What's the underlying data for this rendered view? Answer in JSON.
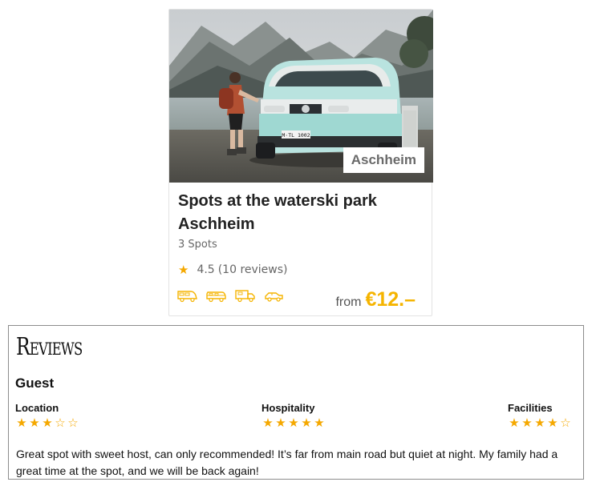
{
  "card": {
    "location_badge": "Aschheim",
    "title": "Spots at the waterski park Aschheim",
    "spot_count": "3 Spots",
    "rating_value": "4.5",
    "rating_reviews": "(10 reviews)",
    "price_from": "from",
    "price_value": "€12.–",
    "vehicle_icons": [
      "motorhome-icon",
      "campervan-icon",
      "truck-camper-icon",
      "car-icon"
    ],
    "van_plate": "M·TL 1002",
    "accent_color": "#f5b400"
  },
  "reviews": {
    "heading": "Reviews",
    "reviewer": "Guest",
    "categories": [
      {
        "label": "Location",
        "stars_filled": 3,
        "stars_total": 5
      },
      {
        "label": "Hospitality",
        "stars_filled": 5,
        "stars_total": 5
      },
      {
        "label": "Facilities",
        "stars_filled": 4,
        "stars_total": 5
      }
    ],
    "text": "Great spot with sweet host, can only recommended! It’s far from main road but quiet at night. My family had a great time at the spot, and we will be back again!"
  }
}
